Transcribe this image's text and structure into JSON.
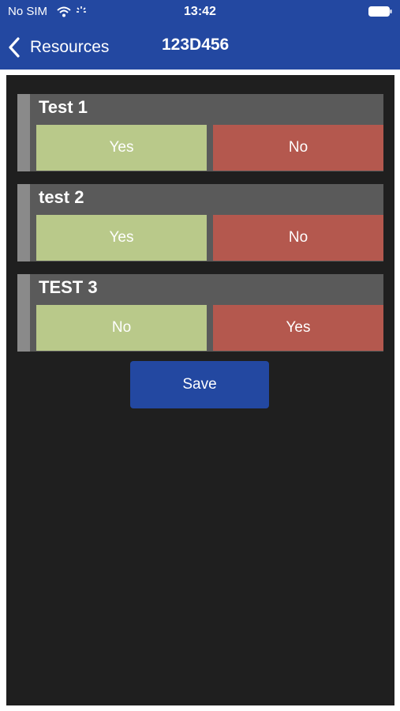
{
  "status_bar": {
    "carrier": "No SIM",
    "time": "13:42",
    "icons": [
      "wifi-icon",
      "activity-icon",
      "battery-icon"
    ]
  },
  "nav": {
    "back_label": "Resources",
    "title": "123D456",
    "back_icon": "chevron-left-icon"
  },
  "questions": [
    {
      "label": "Test 1",
      "options": [
        "Yes",
        "No"
      ]
    },
    {
      "label": "test 2",
      "options": [
        "Yes",
        "No"
      ]
    },
    {
      "label": "TEST 3",
      "options": [
        "No",
        "Yes"
      ]
    }
  ],
  "save_label": "Save",
  "colors": {
    "header": "#2348a1",
    "background": "#1f1f1f",
    "card": "#5a5a5a",
    "option_green": "#b9c98a",
    "option_red": "#b4584e",
    "save_button": "#2348a1"
  }
}
